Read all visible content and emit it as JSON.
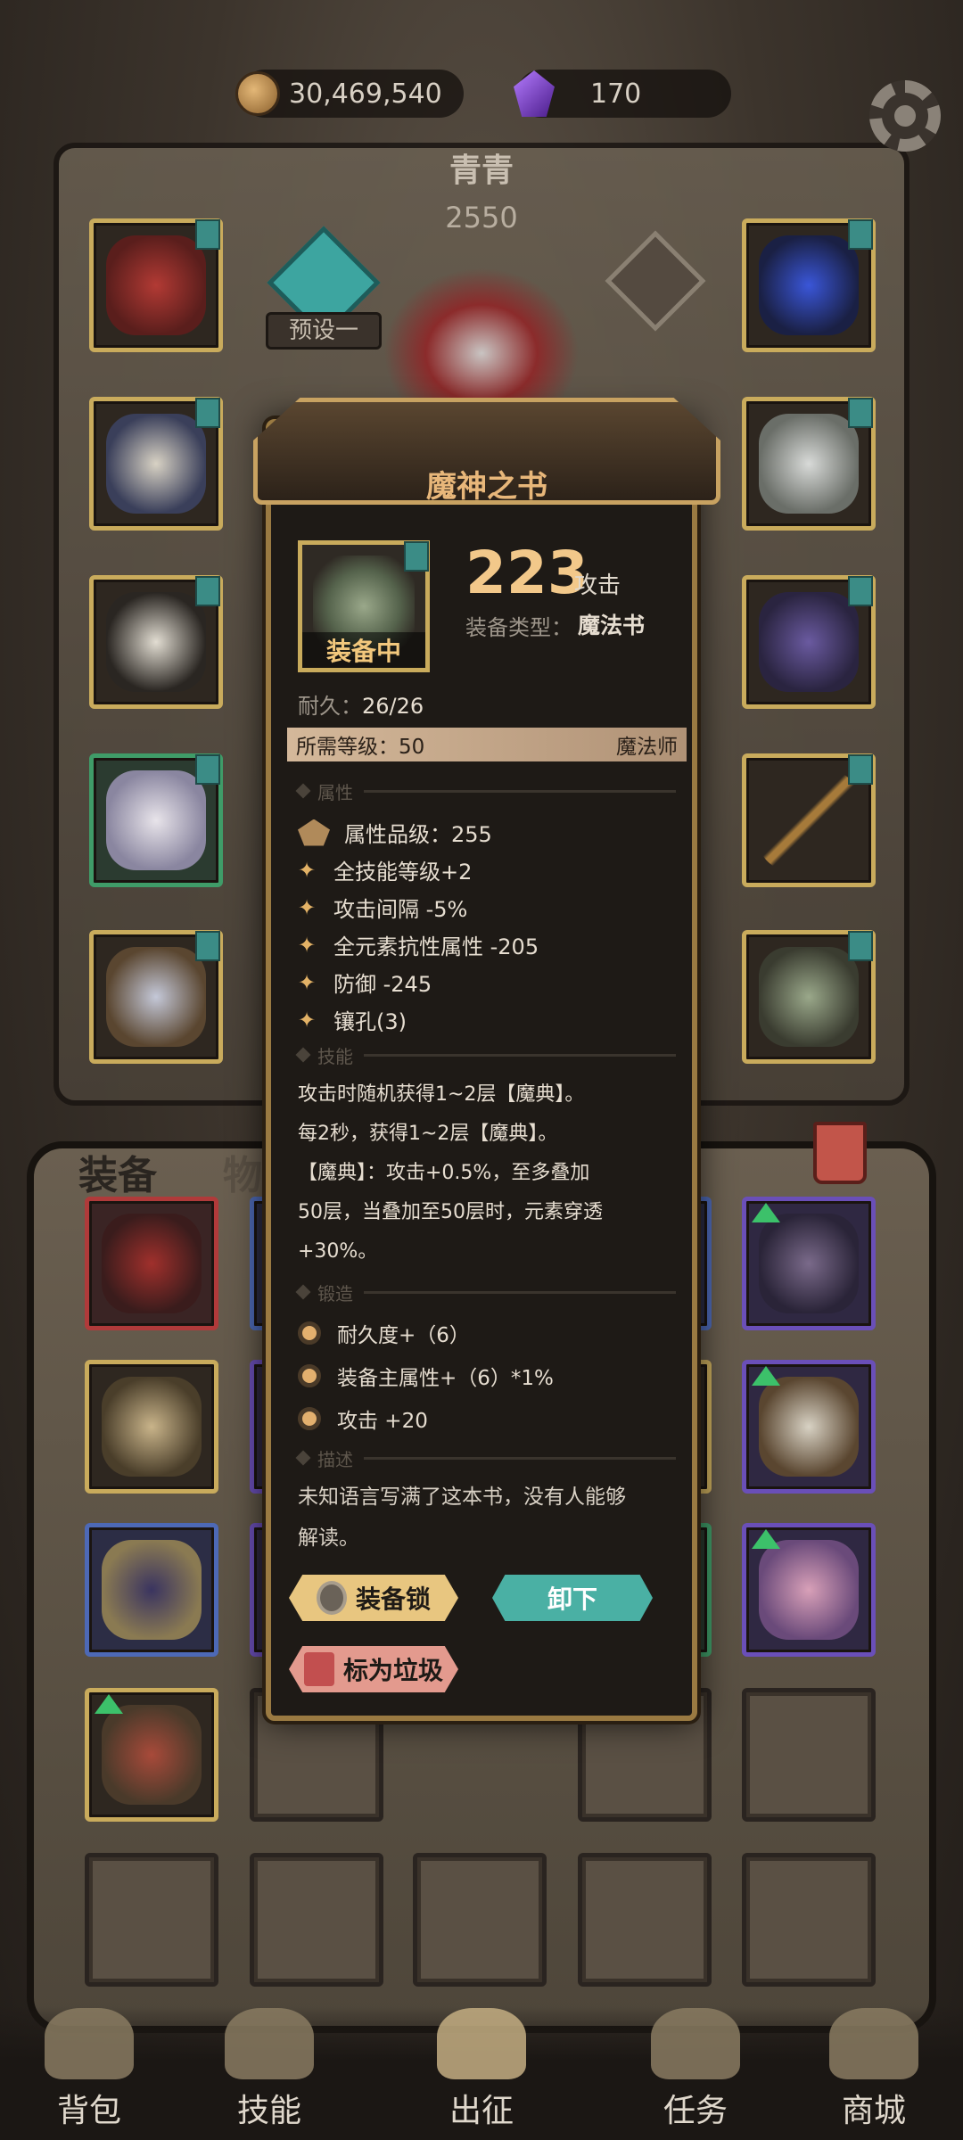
{
  "currency": {
    "gold": "30,469,540",
    "gems": "170"
  },
  "character": {
    "name": "青青",
    "power": "2550",
    "preset_label": "预设一"
  },
  "tabs": {
    "equip": "装备",
    "items": "物品"
  },
  "item": {
    "name": "魔神之书",
    "equipped_label": "装备中",
    "attack_value": "223",
    "attack_label": "攻击",
    "type_label": "装备类型：",
    "type_value": "魔法书",
    "durability_label": "耐久：",
    "durability_value": "26/26",
    "required_level": "所需等级：50",
    "class": "魔法师"
  },
  "sections": {
    "attributes": "属性",
    "skills": "技能",
    "forge": "锻造",
    "description": "描述"
  },
  "attributes": [
    "属性品级：255",
    "全技能等级+2",
    "攻击间隔 -5%",
    "全元素抗性属性 -205",
    "防御 -245",
    "镶孔(3)"
  ],
  "skill_lines": [
    "攻击时随机获得1~2层【魔典】。",
    "每2秒，获得1~2层【魔典】。",
    "【魔典】：攻击+0.5%，至多叠加",
    "50层，当叠加至50层时，元素穿透",
    "+30%。"
  ],
  "forge_lines": [
    "耐久度+（6）",
    "装备主属性+（6）*1%",
    "攻击 +20"
  ],
  "description_lines": [
    "未知语言写满了这本书，没有人能够",
    "解读。"
  ],
  "buttons": {
    "lock": "装备锁",
    "unequip": "卸下",
    "mark_trash": "标为垃圾"
  },
  "nav": {
    "bag": "背包",
    "skills": "技能",
    "expedition": "出征",
    "quests": "任务",
    "shop": "商城"
  },
  "colors": {
    "gold_text": "#f2c88a",
    "teal": "#4ab0a4",
    "frame_gold": "#c9ab5c"
  }
}
